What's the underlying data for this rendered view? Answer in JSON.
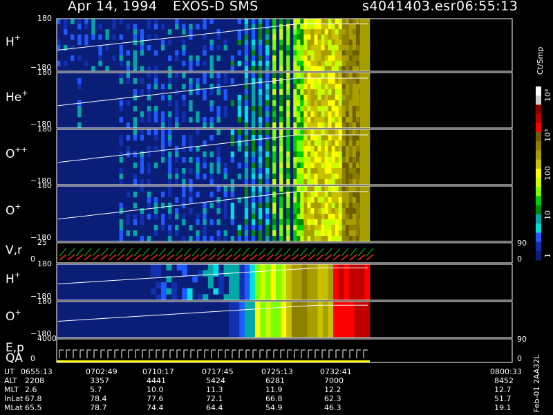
{
  "header": {
    "date": "Apr 14, 1994",
    "instrument": "EXOS-D SMS",
    "file": "s4041403.esr",
    "time": "06:55:13"
  },
  "panels": [
    {
      "id": "h-plus-1",
      "label": "H",
      "sup": "+",
      "ymax": "180",
      "ymin": "−180"
    },
    {
      "id": "he-plus",
      "label": "He",
      "sup": "+",
      "ymax": "180",
      "ymin": "−180"
    },
    {
      "id": "o-plusplus",
      "label": "O",
      "sup": "++",
      "ymax": "180",
      "ymin": "−180"
    },
    {
      "id": "o-plus-1",
      "label": "O",
      "sup": "+",
      "ymax": "180",
      "ymin": "−180"
    },
    {
      "id": "vr",
      "label": "V,r",
      "sup": "",
      "ymax": "25",
      "ymin": "0",
      "right_top": "90",
      "right_bottom": "0"
    },
    {
      "id": "h-plus-2",
      "label": "H",
      "sup": "+",
      "ymax": "180",
      "ymin": "−180"
    },
    {
      "id": "o-plus-2",
      "label": "O",
      "sup": "+",
      "ymax": "180",
      "ymin": "−180"
    },
    {
      "id": "ep",
      "label": "E,p",
      "label2": "QA",
      "sup": "",
      "ymax": "4000",
      "ymin": "0",
      "right_top": "90",
      "right_bottom": "0"
    }
  ],
  "colorbar": {
    "unit": "Ct/Smp",
    "labels": [
      "10",
      "10",
      "100",
      "10",
      "10",
      "1"
    ],
    "exponents": [
      "4",
      "3",
      "",
      "",
      "",
      ""
    ],
    "label_display": [
      "10⁴",
      "10³",
      "100",
      "10",
      "1"
    ],
    "colors": [
      "#ffffff",
      "#d0d0d0",
      "#8b0000",
      "#c00000",
      "#ff0000",
      "#6e6000",
      "#8c8000",
      "#a89e00",
      "#c8c000",
      "#ffff00",
      "#c8ff00",
      "#7cff00",
      "#00d000",
      "#008c00",
      "#00a8a8",
      "#00e0e0",
      "#1e5aff",
      "#1030b0",
      "#0a1e78"
    ]
  },
  "footer": {
    "rows": [
      {
        "name": "UT",
        "values": [
          "0655:13",
          "0702:49",
          "0710:17",
          "0717:45",
          "0725:13",
          "0732:41",
          "0800:33"
        ]
      },
      {
        "name": "ALT",
        "values": [
          "2208",
          "3357",
          "4441",
          "5424",
          "6281",
          "7000",
          "8452"
        ]
      },
      {
        "name": "MLT",
        "values": [
          "2.6",
          "5.7",
          "10.0",
          "11.3",
          "11.9",
          "12.2",
          "12.7"
        ]
      },
      {
        "name": "InLat",
        "values": [
          "67.8",
          "78.4",
          "77.6",
          "72.1",
          "66.8",
          "62.3",
          "51.7"
        ]
      },
      {
        "name": "MLat",
        "values": [
          "65.5",
          "78.7",
          "74.4",
          "64.4",
          "54.9",
          "46.3",
          "19.1"
        ]
      }
    ],
    "side_label": "Feb-01  2AA32L"
  },
  "chart_data": {
    "type": "heatmap",
    "title": "Apr 14, 1994   EXOS-D SMS",
    "x": [
      "0655:13",
      "0702:49",
      "0710:17",
      "0717:45",
      "0725:13",
      "0732:41",
      "0800:33"
    ],
    "panels": [
      "H+",
      "He+",
      "O++",
      "O+",
      "V,r",
      "H+",
      "O+",
      "E,p / QA"
    ],
    "ylim": [
      -180,
      180
    ],
    "colorscale": {
      "unit": "Ct/Smp",
      "scale": "log",
      "range": [
        1,
        10000
      ]
    },
    "ephemeris": {
      "ALT": [
        2208,
        3357,
        4441,
        5424,
        6281,
        7000,
        8452
      ],
      "MLT": [
        2.6,
        5.7,
        10.0,
        11.3,
        11.9,
        12.2,
        12.7
      ],
      "InLat": [
        67.8,
        78.4,
        77.6,
        72.1,
        66.8,
        62.3,
        51.7
      ],
      "MLat": [
        65.5,
        78.7,
        74.4,
        64.4,
        54.9,
        46.3,
        19.1
      ]
    }
  }
}
